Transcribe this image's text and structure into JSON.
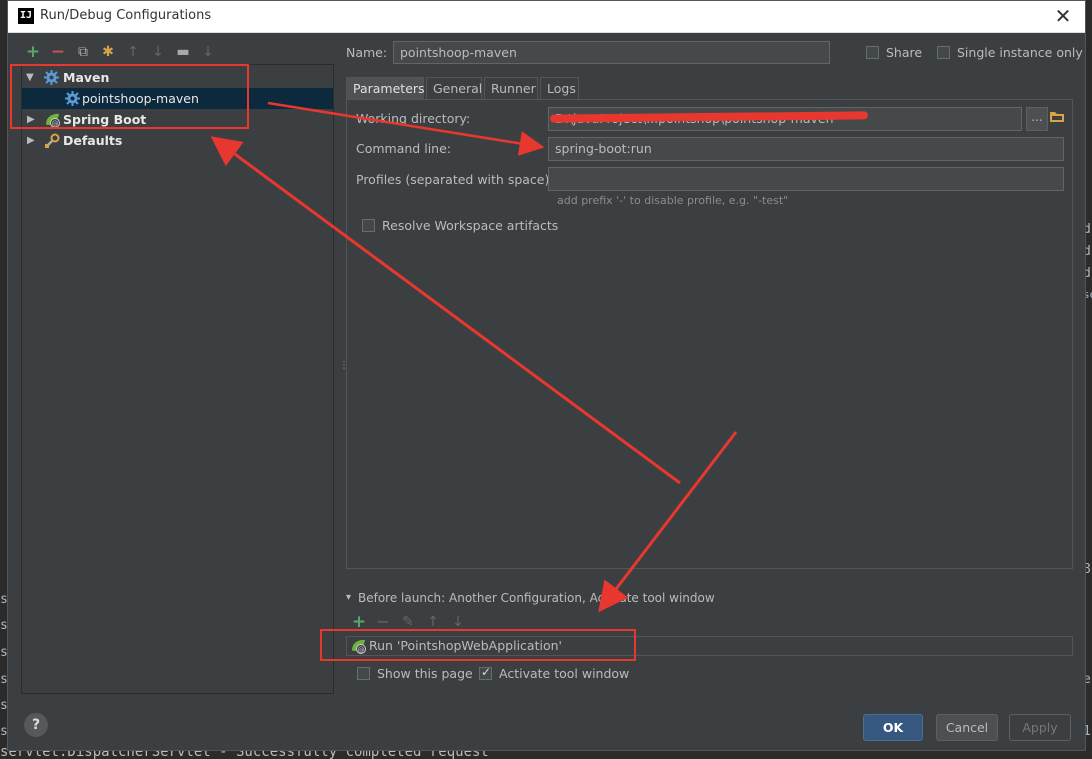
{
  "dialog": {
    "title": "Run/Debug Configurations",
    "logo": "IJ",
    "close_glyph": "✕"
  },
  "toolbar": {
    "add_icon": "+",
    "remove_icon": "−",
    "copy_icon": "⧉",
    "settings_icon": "✱",
    "up_icon": "↑",
    "down_icon": "↓",
    "folder_icon": "▬",
    "sort_icon": "↓"
  },
  "tree": {
    "items": [
      {
        "label": "Maven",
        "expanded": true
      },
      {
        "label": "pointshoop-maven",
        "child": true,
        "selected": true
      },
      {
        "label": "Spring Boot",
        "expanded": false
      },
      {
        "label": "Defaults",
        "expanded": false
      }
    ]
  },
  "name_field": {
    "label": "Name:",
    "value": "pointshoop-maven"
  },
  "share": {
    "label": "Share",
    "checked": false
  },
  "single_instance": {
    "label": "Single instance only",
    "checked": false
  },
  "tabs": [
    {
      "label": "Parameters",
      "active": true
    },
    {
      "label": "General",
      "active": false
    },
    {
      "label": "Runner",
      "active": false
    },
    {
      "label": "Logs",
      "active": false
    }
  ],
  "parameters": {
    "working_directory_label": "Working directory:",
    "working_directory_value": "D:\\javaProject\\...pointshop\\pointshop-maven",
    "command_line_label": "Command line:",
    "command_line_value": "spring-boot:run",
    "profiles_label": "Profiles (separated with space):",
    "profiles_value": "",
    "profiles_hint": "add prefix '-' to disable profile, e.g. \"-test\"",
    "resolve_workspace_label": "Resolve Workspace artifacts",
    "resolve_workspace_checked": false,
    "browse_label": "..."
  },
  "before_launch": {
    "header": "Before launch: Another Configuration, Activate tool window",
    "toggle_glyph": "▾",
    "items": [
      "Run 'PointshopWebApplication'"
    ],
    "add_icon": "+",
    "remove_icon": "−",
    "edit_icon": "✎",
    "up_icon": "↑",
    "down_icon": "↓"
  },
  "show_this_page": {
    "label": "Show this page",
    "checked": false
  },
  "activate_tool_window": {
    "label": "Activate tool window",
    "checked": true
  },
  "buttons": {
    "ok": "OK",
    "cancel": "Cancel",
    "apply": "Apply",
    "help": "?"
  },
  "background": {
    "bottom_log": "servlet.DispatcherServlet - Successfully completed request",
    "right_glyphs": [
      "d",
      "d",
      "d",
      "se",
      "8",
      "e",
      "1"
    ],
    "left_glyphs": [
      "s",
      "s",
      "s",
      "s",
      "s",
      "s"
    ]
  },
  "colors": {
    "annotation_red": "#e8372e",
    "selection_blue": "#0d293e",
    "primary_button": "#365880",
    "spring_green": "#6db33f",
    "add_green": "#59a869",
    "remove_red": "#c75450"
  }
}
